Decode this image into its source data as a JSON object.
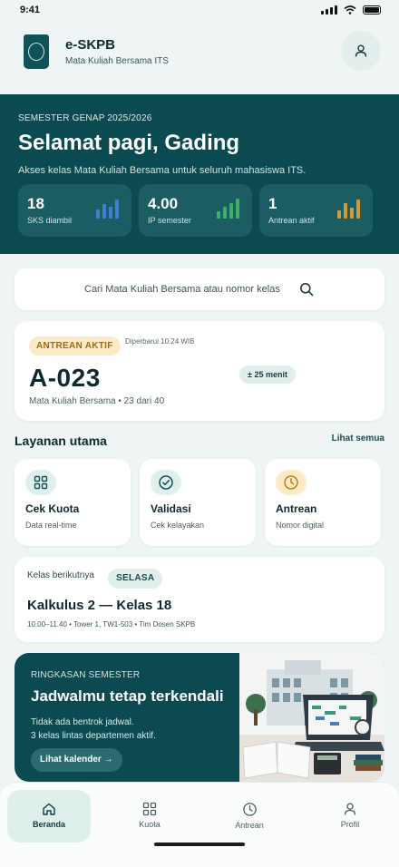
{
  "status_bar": {
    "time": "9:41"
  },
  "header": {
    "app_name": "e-SKPB",
    "subtitle": "Mata Kuliah Bersama ITS",
    "profile_icon": "user-icon"
  },
  "hero": {
    "eyebrow": "SEMESTER GENAP 2025/2026",
    "greeting": "Selamat pagi, Gading",
    "description": "Akses kelas Mata Kuliah Bersama untuk seluruh mahasiswa ITS.",
    "stats": [
      {
        "value": "18",
        "label": "SKS diambil",
        "color": "#3f7fd0"
      },
      {
        "value": "4.00",
        "label": "IP semester",
        "color": "#3fae6a"
      },
      {
        "value": "1",
        "label": "Antrean aktif",
        "color": "#d39a35"
      }
    ]
  },
  "search": {
    "placeholder": "Cari Mata Kuliah Bersama atau nomor kelas"
  },
  "queue": {
    "badge": "ANTREAN AKTIF",
    "updated": "Diperbarui 10.24 WIB",
    "number": "A-023",
    "description": "Mata Kuliah Bersama • 23 dari 40",
    "eta": "± 25 menit"
  },
  "services": {
    "title": "Layanan utama",
    "see_all": "Lihat semua",
    "items": [
      {
        "title": "Cek Kuota",
        "subtitle": "Data real-time",
        "icon": "grid-icon",
        "bg": "#dff0ec"
      },
      {
        "title": "Validasi",
        "subtitle": "Cek kelayakan",
        "icon": "check-circle-icon",
        "bg": "#dff0ec"
      },
      {
        "title": "Antrean",
        "subtitle": "Nomor digital",
        "icon": "clock-icon",
        "bg": "#fdebc8"
      }
    ]
  },
  "next_class": {
    "label": "Kelas berikutnya",
    "day": "SELASA",
    "title": "Kalkulus 2 — Kelas 18",
    "meta": "10.00–11.40  •  Tower 1, TW1-503  •  Tim Dosen SKPB"
  },
  "summary": {
    "eyebrow": "RINGKASAN SEMESTER",
    "title": "Jadwalmu tetap terkendali",
    "line1": "Tidak ada bentrok jadwal.",
    "line2": "3 kelas lintas departemen aktif.",
    "button": "Lihat kalender →"
  },
  "nav": [
    {
      "label": "Beranda",
      "icon": "home-icon",
      "active": true
    },
    {
      "label": "Kuota",
      "icon": "grid-icon",
      "active": false
    },
    {
      "label": "Antrean",
      "icon": "clock-icon",
      "active": false
    },
    {
      "label": "Profil",
      "icon": "user-icon",
      "active": false
    }
  ]
}
